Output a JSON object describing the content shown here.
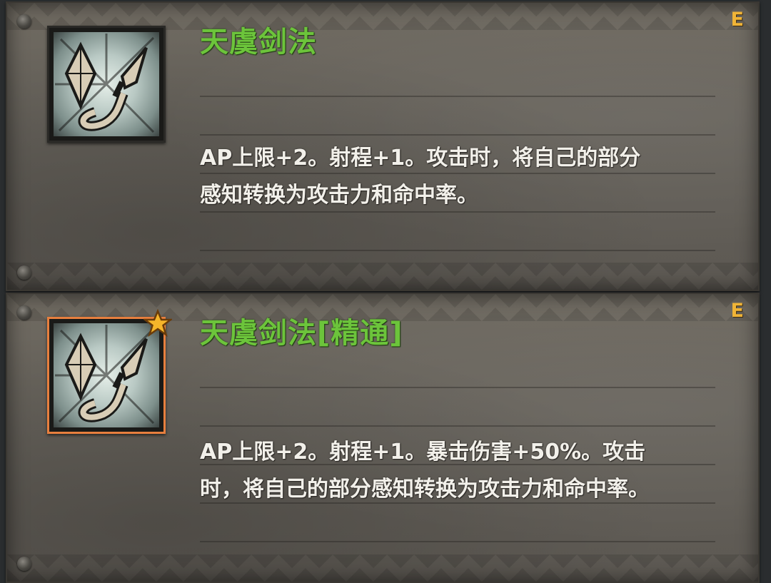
{
  "skills": [
    {
      "name": "天虞剑法",
      "grade": "E",
      "description_lines": [
        "AP上限+2。射程+1。攻击时，将自己的部分",
        "感知转换为攻击力和命中率。"
      ],
      "icon": "sword-tassel-icon",
      "mastered": false
    },
    {
      "name": "天虞剑法[精通]",
      "grade": "E",
      "description_lines": [
        "AP上限+2。射程+1。暴击伤害+50%。攻击",
        "时，将自己的部分感知转换为攻击力和命中率。"
      ],
      "icon": "sword-tassel-icon",
      "mastered": true,
      "badge_icon": "star-icon"
    }
  ],
  "colors": {
    "title": "#6cc43b",
    "grade": "#f0b437",
    "mastered_frame": "#e77f3e",
    "description": "#f2f0ea"
  }
}
